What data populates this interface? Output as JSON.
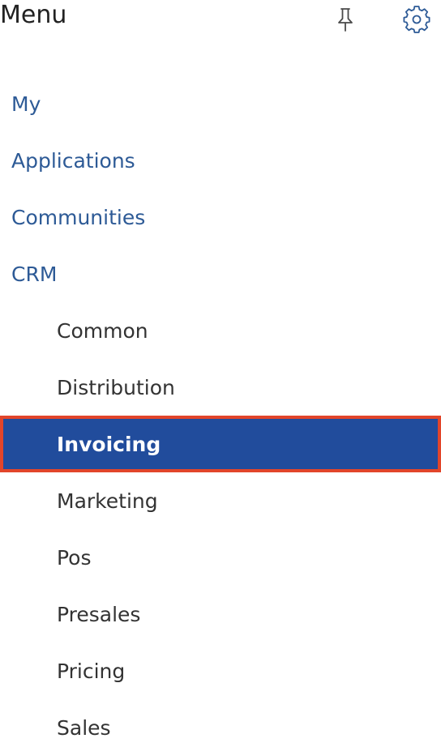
{
  "header": {
    "title": "Menu",
    "pin_icon": "pin-icon",
    "settings_icon": "gear-icon"
  },
  "menu": {
    "top_items": [
      {
        "label": "My"
      },
      {
        "label": "Applications"
      },
      {
        "label": "Communities"
      },
      {
        "label": "CRM"
      }
    ],
    "crm_children": [
      {
        "label": "Common"
      },
      {
        "label": "Distribution"
      },
      {
        "label": "Invoicing",
        "selected": true
      },
      {
        "label": "Marketing"
      },
      {
        "label": "Pos"
      },
      {
        "label": "Presales"
      },
      {
        "label": "Pricing"
      },
      {
        "label": "Sales"
      }
    ]
  },
  "colors": {
    "link": "#2d5a96",
    "subitem_text": "#333333",
    "selected_bg": "#214c9c",
    "selected_outline": "#e2452a"
  }
}
